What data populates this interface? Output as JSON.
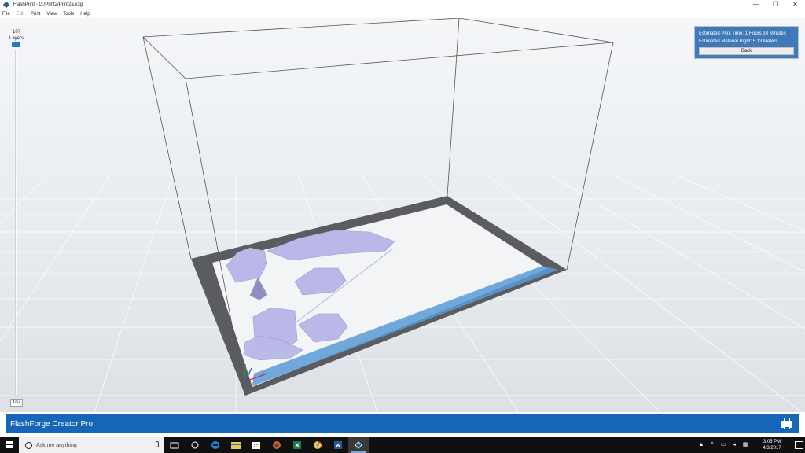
{
  "window": {
    "title": "FlashPrint - G:/Print2/Print2a.x3g",
    "controls": {
      "minimize": "—",
      "restore": "❐",
      "close": "✕"
    }
  },
  "menu": [
    "File",
    "Edit",
    "Print",
    "View",
    "Tools",
    "Help"
  ],
  "menu_disabled": [
    "Edit"
  ],
  "layers": {
    "top_value": "107",
    "top_label": "Layers",
    "bottom_value": "107"
  },
  "info": {
    "print_time": "Estimated Print Time: 1 Hours 38 Minutes",
    "material": "Estimated Material Right: 5.13 Meters",
    "back_label": "Back"
  },
  "status": {
    "printer_name": "FlashForge Creator Pro"
  },
  "taskbar": {
    "search_placeholder": "Ask me anything",
    "clock_time": "3:05 PM",
    "clock_date": "4/3/2017"
  },
  "colors": {
    "accent": "#1565b8",
    "model": "#b9b8e8",
    "plate_border": "#5a5c5f",
    "plate_highlight": "#5a9ad6",
    "info_panel": "#3f79b8"
  }
}
